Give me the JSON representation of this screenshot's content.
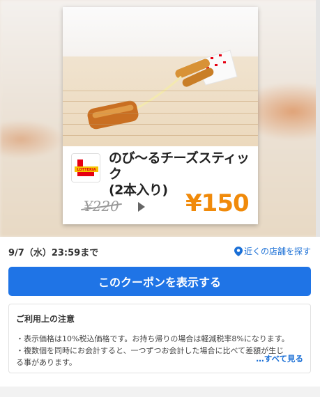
{
  "coupon": {
    "title_line1": "のび～るチーズスティック",
    "title_line2": "(2本入り)",
    "old_price": "¥220",
    "new_price": "¥150",
    "brand_logo_text": "LOTTERIA"
  },
  "meta": {
    "deadline": "9/7（水）23:59まで",
    "nearby_label": "近くの店舗を探す"
  },
  "cta": {
    "label": "このクーポンを表示する"
  },
  "notes": {
    "title": "ご利用上の注意",
    "line1": "・表示価格は10%税込価格です。お持ち帰りの場合は軽減税率8%になります。",
    "line2": "・複数個を同時にお会計すると、一つずつお会計した場合に比べて差額が生じ",
    "line3": "る事があります。",
    "see_all": "…すべて見る"
  },
  "colors": {
    "accent_blue": "#1f74e6",
    "price_orange": "#f08a0a",
    "brand_red": "#e60012"
  }
}
